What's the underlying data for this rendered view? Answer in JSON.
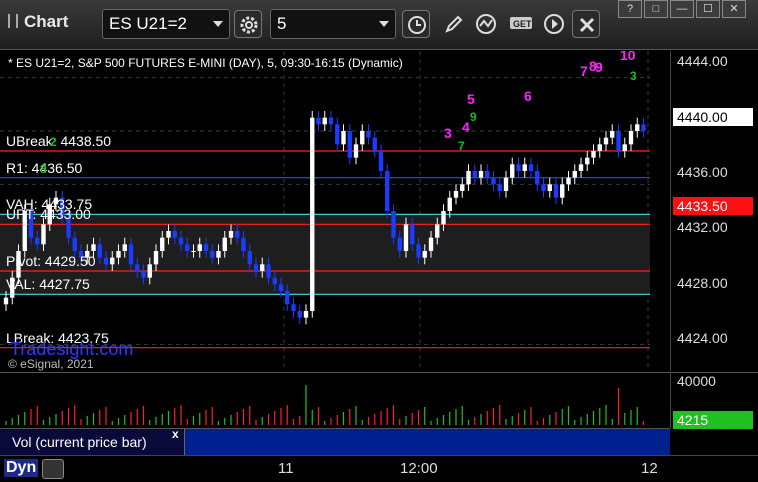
{
  "toolbar": {
    "app_title": "Chart",
    "symbol_value": "ES U21=2",
    "interval_value": "5",
    "buttons": [
      "settings-icon",
      "clock-icon",
      "pencil-icon",
      "indicator-icon",
      "get-icon",
      "play-icon",
      "close-icon"
    ],
    "window_controls": [
      "?",
      "□",
      "—",
      "☐",
      "✕"
    ]
  },
  "chart": {
    "title": "* ES U21=2, S&P 500 FUTURES E-MINI (DAY), 5, 09:30-16:15 (Dynamic)",
    "watermark": "Tradesight.com",
    "copyright": "© eSignal, 2021",
    "levels": [
      {
        "label": "UBreak: 4438.50",
        "price": 4438.5,
        "color": "#ff2020"
      },
      {
        "label": "R1: 4436.50",
        "price": 4436.5,
        "color": "#2050ff"
      },
      {
        "label": "VAH: 4433.75",
        "price": 4433.75,
        "color": "#40e0e0"
      },
      {
        "label": "UPT: 4433.00",
        "price": 4433.0,
        "color": "#ff2020"
      },
      {
        "label": "Pivot: 4429.50",
        "price": 4429.5,
        "color": "#ff2020"
      },
      {
        "label": "VAL: 4427.75",
        "price": 4427.75,
        "color": "#40e0e0"
      },
      {
        "label": "LBreak: 4423.75",
        "price": 4423.75,
        "color": "#ff2020"
      }
    ],
    "sequence_labels": [
      "3",
      "4",
      "5",
      "6",
      "7",
      "8",
      "9",
      "10"
    ],
    "green_labels": [
      "8",
      "9",
      "7",
      "2",
      "3"
    ],
    "colors": {
      "up": "#ffffff",
      "down": "#1a3cff",
      "bg": "#000000",
      "grid": "#444444"
    }
  },
  "price_axis": {
    "ticks": [
      "4444.00",
      "4440.00",
      "4436.00",
      "4432.00",
      "4428.00",
      "4424.00"
    ],
    "last_price": "4440.00",
    "upt_tag": "4433.50"
  },
  "volume": {
    "legend": "Vol (current price bar)",
    "close_label": "x",
    "axis_max": "40000",
    "current_value": "4215"
  },
  "time_axis": {
    "labels": [
      "11",
      "12:00",
      "12"
    ],
    "dyn_label": "Dyn"
  },
  "chart_data": {
    "type": "candlestick",
    "title": "* ES U21=2, S&P 500 FUTURES E-MINI (DAY), 5, 09:30-16:15 (Dynamic)",
    "ylim": [
      4422,
      4446
    ],
    "closes": [
      4427.5,
      4429,
      4431,
      4434,
      4432,
      4431.5,
      4433,
      4434.5,
      4435,
      4433.5,
      4432,
      4431,
      4430.5,
      4431,
      4431.5,
      4430.5,
      4430,
      4430.5,
      4431,
      4431.5,
      4430,
      4429.5,
      4429,
      4430,
      4431,
      4432,
      4432.5,
      4432,
      4431.5,
      4431,
      4431,
      4431.5,
      4431,
      4430.5,
      4431,
      4432,
      4432.5,
      4432,
      4431,
      4430,
      4429.5,
      4430,
      4429,
      4428.5,
      4428,
      4427,
      4426.5,
      4426,
      4426.5,
      4441,
      4440.5,
      4441,
      4440.5,
      4439,
      4440,
      4438,
      4439,
      4440,
      4439.5,
      4438.5,
      4437,
      4434,
      4432,
      4431,
      4433,
      4431.5,
      4430.5,
      4431,
      4432,
      4433,
      4434,
      4435,
      4435.5,
      4436,
      4437,
      4436.5,
      4437,
      4436.5,
      4436,
      4435.5,
      4436.5,
      4437.5,
      4437,
      4437.5,
      4437,
      4436,
      4435.5,
      4436,
      4435,
      4436,
      4436.5,
      4437,
      4437.5,
      4438,
      4438.5,
      4439,
      4439.5,
      4440,
      4438.5,
      4439,
      4440,
      4440.5,
      4440
    ]
  }
}
